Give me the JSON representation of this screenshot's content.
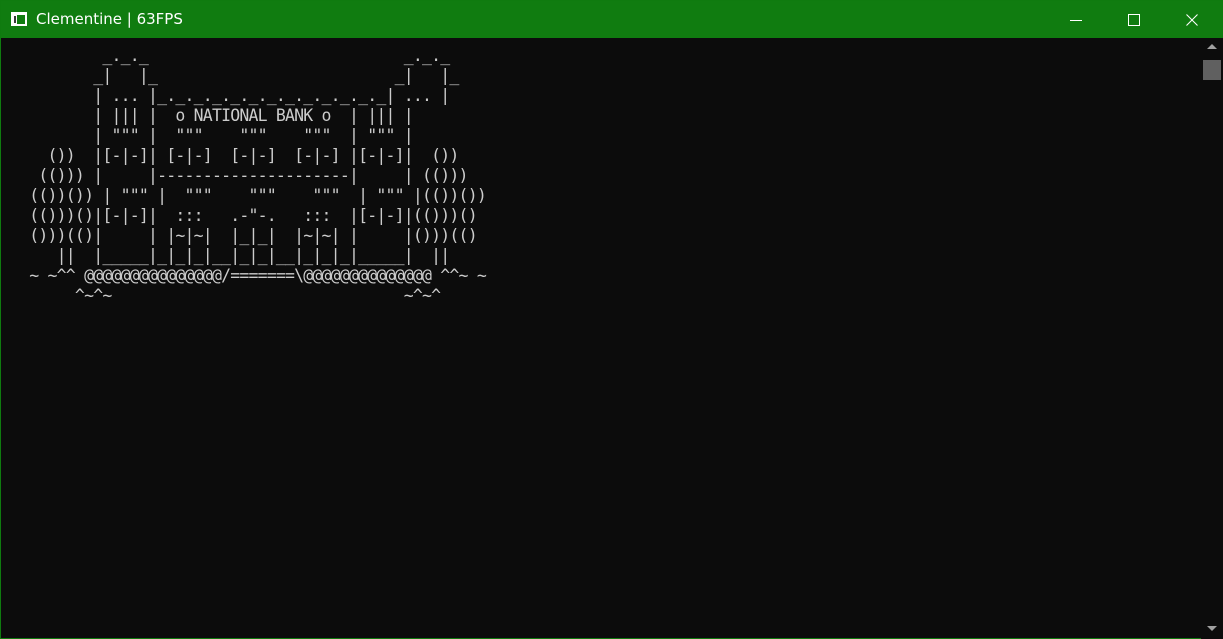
{
  "window": {
    "title": "Clementine | 63FPS",
    "titlebar_color": "#107c10",
    "icons": {
      "app": "console-window-icon",
      "minimize": "minimize-icon",
      "maximize": "maximize-icon",
      "close": "close-icon"
    }
  },
  "console": {
    "background": "#0c0c0c",
    "foreground": "#cccccc",
    "art_lines": [
      "          _._._                            _._._",
      "         _|   |_                          _|   |_",
      "         | ... |_._._._._._._._._._._._._| ... |",
      "         | ||| |  o NATIONAL BANK o  | ||| |",
      "         | \"\"\" |  \"\"\"    \"\"\"    \"\"\"  | \"\"\" |",
      "    ())  |[-|-]| [-|-]  [-|-]  [-|-] |[-|-]|  ())",
      "   (())) |     |---------------------|     | (()))",
      "  (())()) | \"\"\" |  \"\"\"    \"\"\"    \"\"\"  | \"\"\" |(())())",
      "  (()))()|[-|-]|  :::   .-\"-.   :::  |[-|-]|(()))()",
      "  ()))(()|     | |~|~|  |_|_|  |~|~| |     |()))(()",
      "     ||  |_____|_|_|_|__|_|_|__|_|_|_|_____|  ||",
      "  ~ ~^^ @@@@@@@@@@@@@@@/=======\\@@@@@@@@@@@@@@ ^^~ ~",
      "       ^~^~                                ~^~^"
    ]
  },
  "scrollbar": {
    "up_icon": "scroll-up-arrow-icon",
    "down_icon": "scroll-down-arrow-icon"
  }
}
